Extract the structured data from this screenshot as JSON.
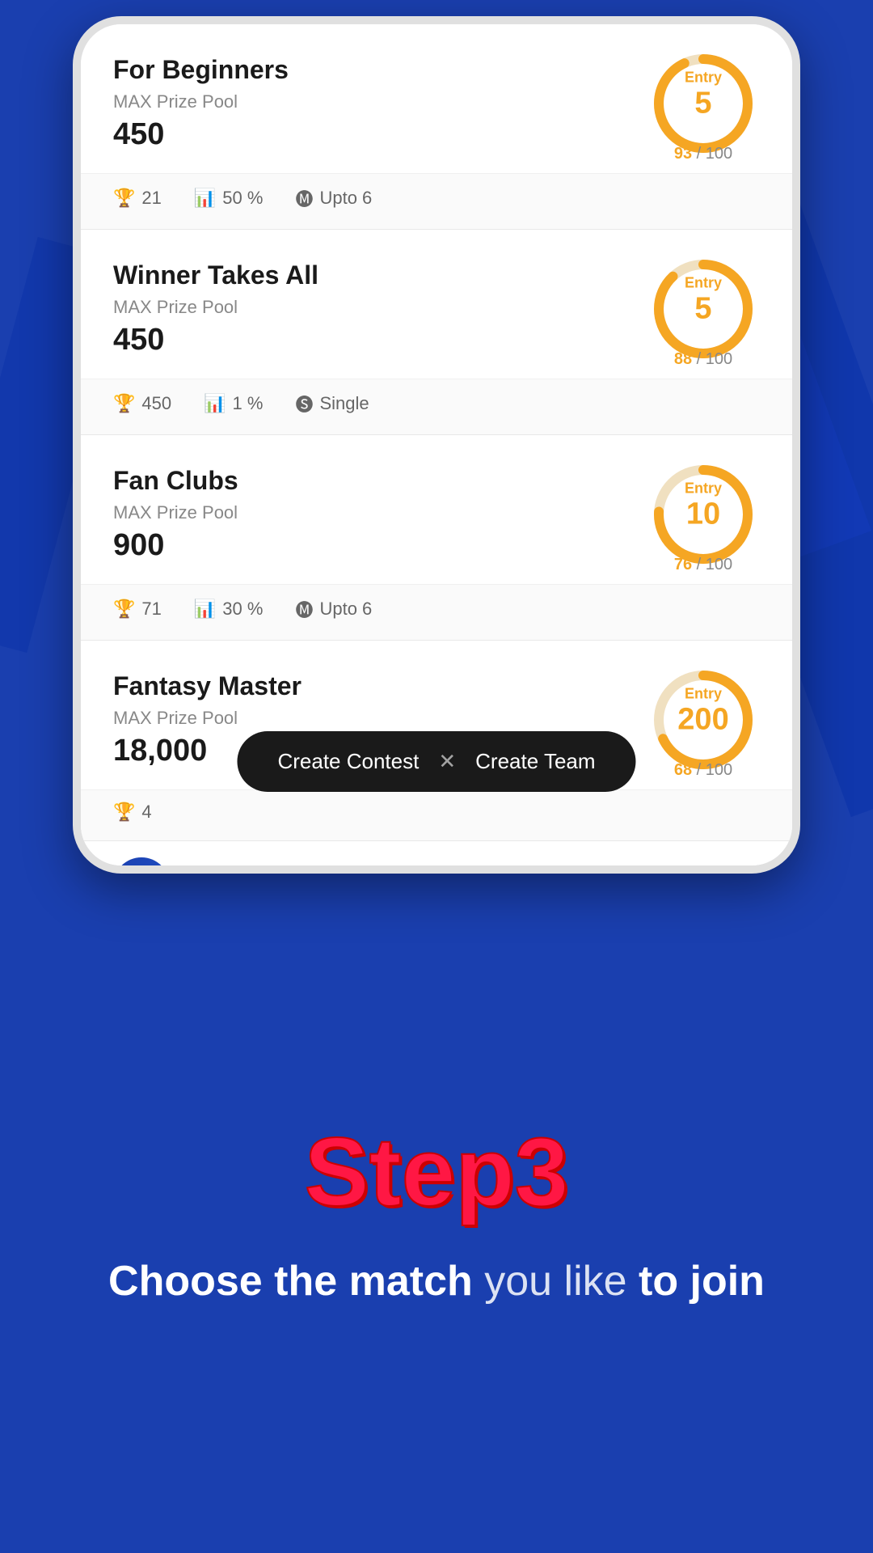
{
  "background": {
    "color": "#1a3faf"
  },
  "contests": [
    {
      "id": "beginners",
      "name": "For Beginners",
      "prize_label": "MAX Prize Pool",
      "prize_amount": "450",
      "entry": "5",
      "filled": 93,
      "total": 100,
      "stats": [
        {
          "icon": "trophy",
          "value": "21"
        },
        {
          "icon": "bar-chart",
          "value": "50 %"
        },
        {
          "icon": "multi",
          "value": "Upto 6"
        }
      ],
      "donut_percent": 93
    },
    {
      "id": "winner-takes-all",
      "name": "Winner Takes All",
      "prize_label": "MAX Prize Pool",
      "prize_amount": "450",
      "entry": "5",
      "filled": 88,
      "total": 100,
      "stats": [
        {
          "icon": "trophy",
          "value": "450"
        },
        {
          "icon": "bar-chart",
          "value": "1 %"
        },
        {
          "icon": "single",
          "value": "Single"
        }
      ],
      "donut_percent": 88
    },
    {
      "id": "fan-clubs",
      "name": "Fan Clubs",
      "prize_label": "MAX Prize Pool",
      "prize_amount": "900",
      "entry": "10",
      "filled": 76,
      "total": 100,
      "stats": [
        {
          "icon": "trophy",
          "value": "71"
        },
        {
          "icon": "bar-chart",
          "value": "30 %"
        },
        {
          "icon": "multi",
          "value": "Upto 6"
        }
      ],
      "donut_percent": 76
    },
    {
      "id": "fantasy-master",
      "name": "Fantasy Master",
      "prize_label": "MAX Prize Pool",
      "prize_amount": "18,000",
      "entry": "200",
      "filled": 68,
      "total": 100,
      "stats": [
        {
          "icon": "trophy",
          "value": "4"
        },
        {
          "icon": "bar-chart",
          "value": "..."
        },
        {
          "icon": "multi",
          "value": "..."
        }
      ],
      "donut_percent": 68
    }
  ],
  "action_bar": {
    "create_contest_label": "Create Contest",
    "divider": "✕",
    "create_team_label": "Create Team"
  },
  "step": {
    "title": "Step3",
    "subtitle_part1": "Choose the match",
    "subtitle_part2": " you like ",
    "subtitle_part3": "to join"
  },
  "labels": {
    "entry": "Entry",
    "slot_separator": "/ 100",
    "max_prize_pool": "MAX Prize Pool"
  }
}
